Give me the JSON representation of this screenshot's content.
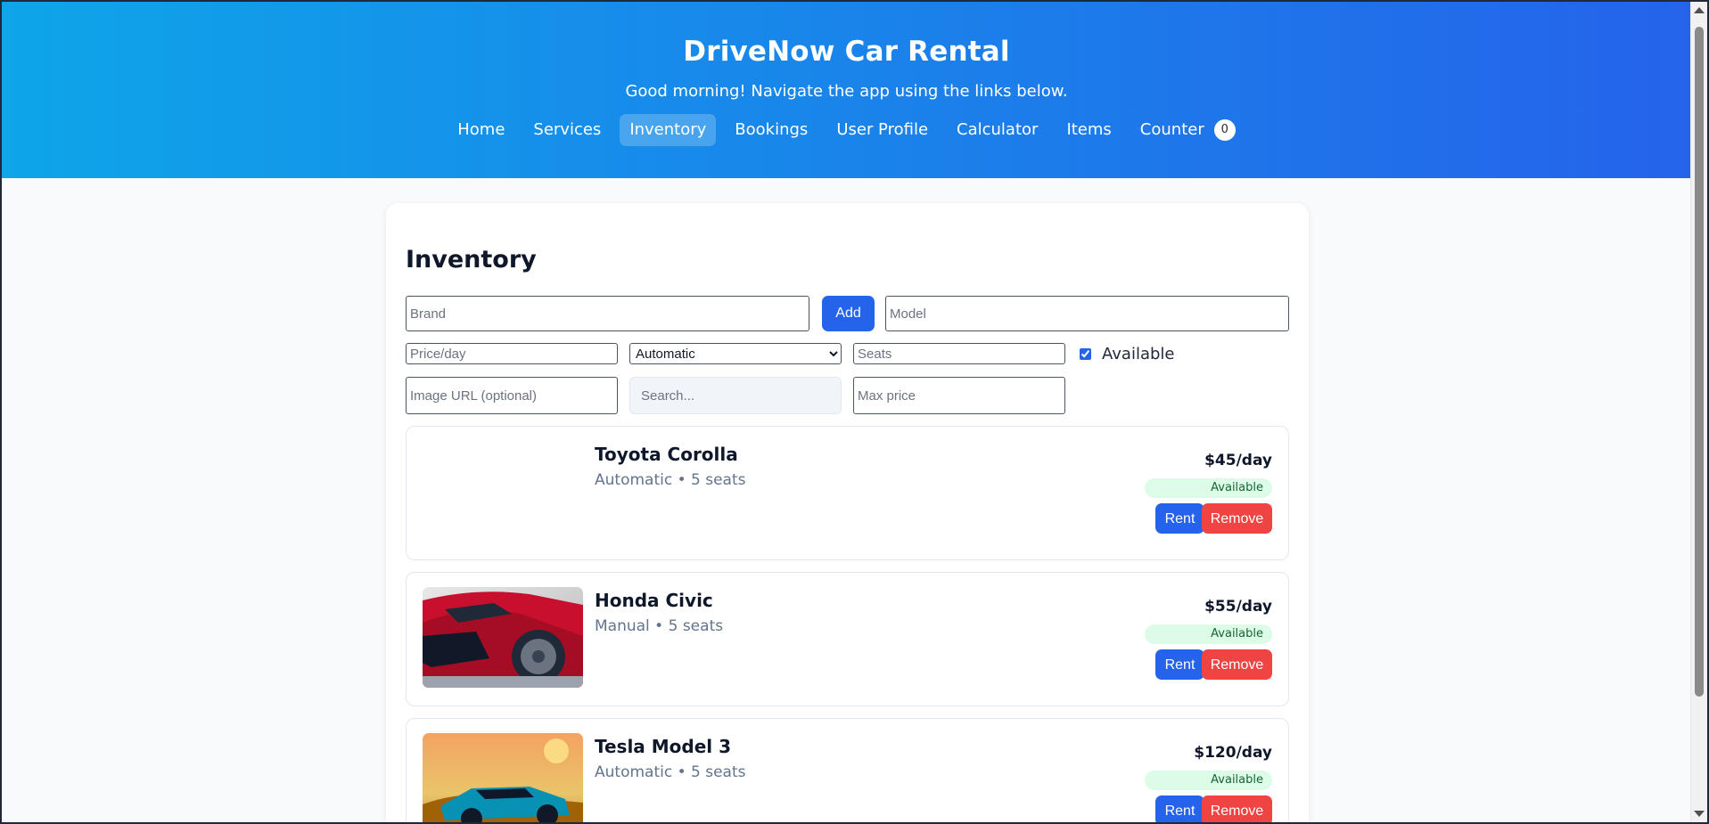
{
  "header": {
    "title": "DriveNow Car Rental",
    "subtitle": "Good morning! Navigate the app using the links below.",
    "nav": [
      {
        "label": "Home",
        "active": false
      },
      {
        "label": "Services",
        "active": false
      },
      {
        "label": "Inventory",
        "active": true
      },
      {
        "label": "Bookings",
        "active": false
      },
      {
        "label": "User Profile",
        "active": false
      },
      {
        "label": "Calculator",
        "active": false
      },
      {
        "label": "Items",
        "active": false
      },
      {
        "label": "Counter",
        "active": false
      }
    ],
    "counter_value": "0",
    "gradient_from": "#0ea5e9",
    "gradient_to": "#2563eb"
  },
  "inventory": {
    "title": "Inventory",
    "form": {
      "brand_placeholder": "Brand",
      "add_label": "Add",
      "model_placeholder": "Model",
      "price_placeholder": "Price/day",
      "transmission_selected": "Automatic",
      "transmission_options": [
        "Automatic"
      ],
      "seats_placeholder": "Seats",
      "available_label": "Available",
      "available_checked": true,
      "image_url_placeholder": "Image URL (optional)",
      "search_placeholder": "Search...",
      "max_price_placeholder": "Max price"
    },
    "cars": [
      {
        "name": "Toyota Corolla",
        "meta": "Automatic • 5 seats",
        "price": "$45/day",
        "status": "Available",
        "rent_label": "Rent",
        "remove_label": "Remove",
        "image": "none"
      },
      {
        "name": "Honda Civic",
        "meta": "Manual • 5 seats",
        "price": "$55/day",
        "status": "Available",
        "rent_label": "Rent",
        "remove_label": "Remove",
        "image": "red-car-photo"
      },
      {
        "name": "Tesla Model 3",
        "meta": "Automatic • 5 seats",
        "price": "$120/day",
        "status": "Available",
        "rent_label": "Rent",
        "remove_label": "Remove",
        "image": "blue-car-photo"
      }
    ]
  },
  "colors": {
    "primary": "#2563eb",
    "danger": "#ef4444",
    "available_bg": "#dcfce7",
    "available_text": "#166534"
  }
}
